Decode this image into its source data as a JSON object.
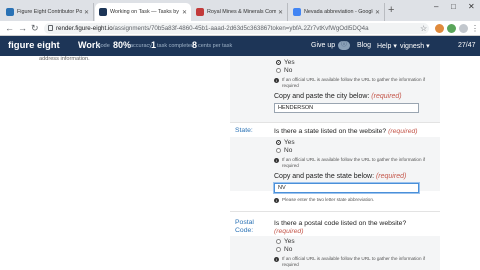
{
  "browser": {
    "tabs": [
      {
        "label": "Figure Eight Contributor Portal",
        "favicon_color": "#2a72b5"
      },
      {
        "label": "Working on Task — Tasks by Fi...",
        "favicon_color": "#1d3557"
      },
      {
        "label": "Royal Mines & Minerals Compan",
        "favicon_color": "#c23a3a"
      },
      {
        "label": "Nevada abbreviation - Google Se",
        "favicon_color": "#4285f4"
      }
    ],
    "new_tab": "+",
    "window_controls": [
      "–",
      "□",
      "✕"
    ],
    "url_host": "render.figure-eight.io",
    "url_path": "/assignments/70b5a83f-4860-45b1-aaad-2d63d5c363867token=ybfA.2Zr7vtKvfWgOdl5DQ4a"
  },
  "header": {
    "brand": "figure eight",
    "work_label": "Work",
    "work_sub": "mode",
    "accuracy_value": "80%",
    "accuracy_sub": "accuracy",
    "tasks_value": "1",
    "tasks_sub": "task completed",
    "cents_value": "8",
    "cents_sub": "cents per task",
    "give_up": "Give up",
    "badge": "ⓘ",
    "blog": "Blog",
    "help": "Help ▾",
    "user": "vignesh ▾",
    "counter": "27/47"
  },
  "content": {
    "address_note": "address information.",
    "city": {
      "yes": "Yes",
      "no": "No",
      "hint": "If an official URL is available follow the URL to gather the information if required",
      "copy_label": "Copy and paste the city below:",
      "required": "(required)",
      "value": "HENDERSON"
    },
    "state": {
      "left_label": "State:",
      "question": "Is there a state listed on the website?",
      "required": "(required)",
      "yes": "Yes",
      "no": "No",
      "hint": "If an official URL is available follow the URL to gather the information if required",
      "copy_label": "Copy and paste the state below:",
      "copy_required": "(required)",
      "value": "NV",
      "abbr_hint": "Please enter the two letter state abbreviation."
    },
    "postal": {
      "left_label_1": "Postal",
      "left_label_2": "Code:",
      "question": "Is there a postal code listed on the website?",
      "required": "(required)",
      "yes": "Yes",
      "no": "No",
      "hint": "If an official URL is available follow the URL to gather the information if required"
    }
  }
}
